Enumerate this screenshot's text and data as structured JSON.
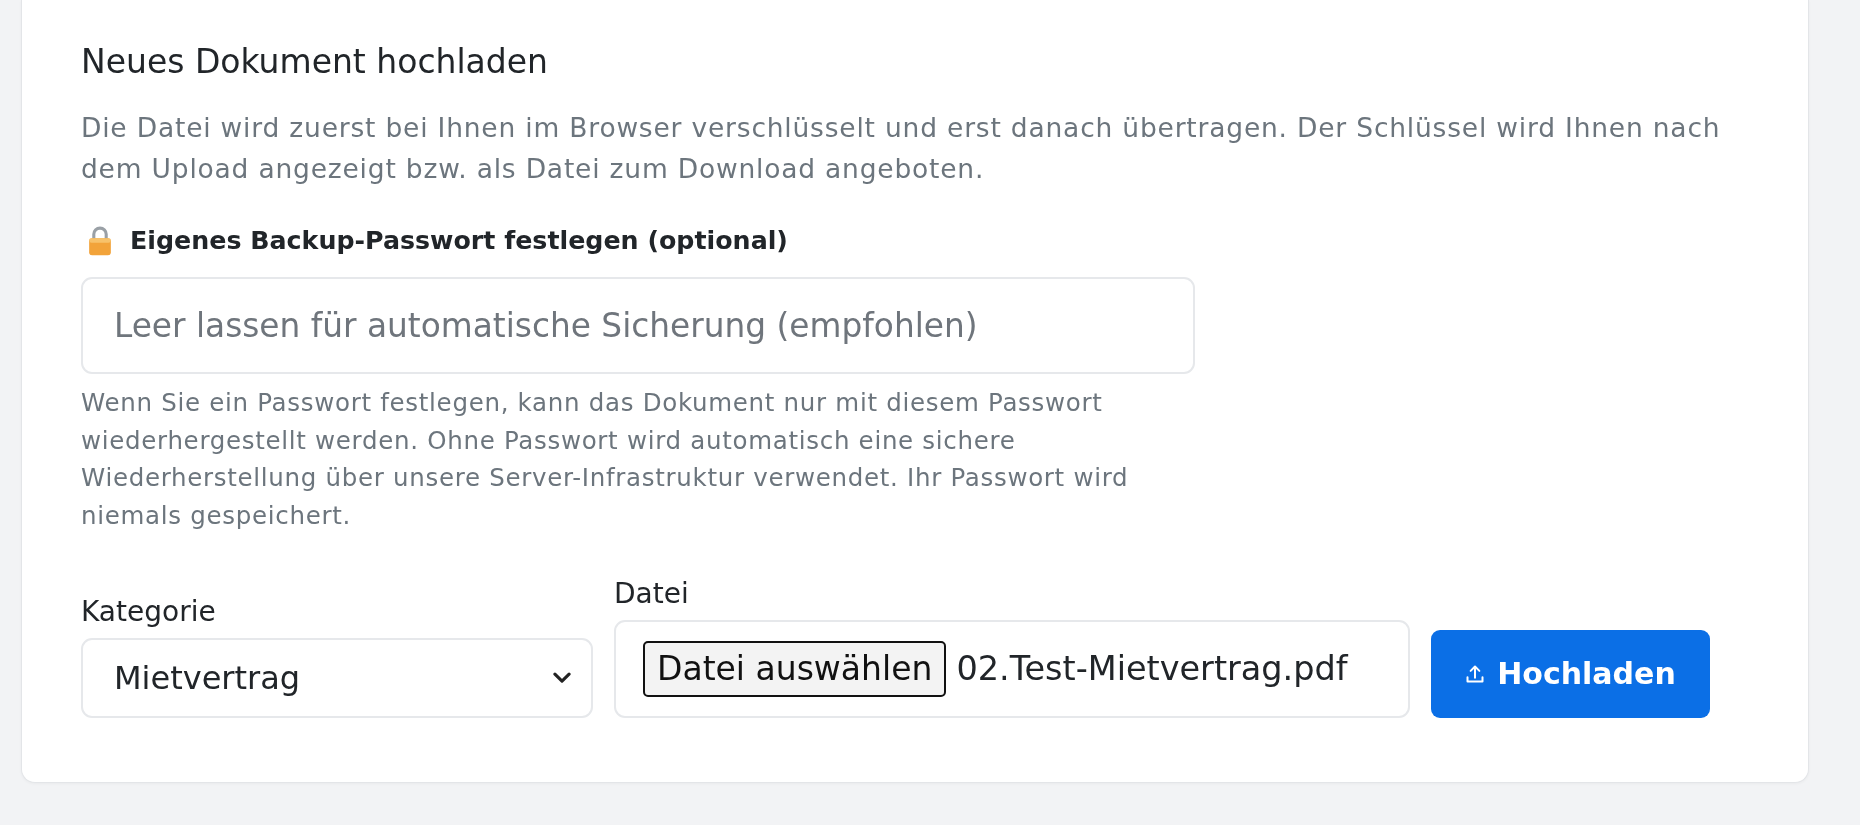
{
  "upload_card": {
    "title": "Neues Dokument hochladen",
    "description": "Die Datei wird zuerst bei Ihnen im Browser verschlüsselt und erst danach übertragen. Der Schlüssel wird Ihnen nach dem Upload angezeigt bzw. als Datei zum Download angeboten.",
    "password": {
      "label": "Eigenes Backup-Passwort festlegen (optional)",
      "placeholder": "Leer lassen für automatische Sicherung (empfohlen)",
      "help": "Wenn Sie ein Passwort festlegen, kann das Dokument nur mit diesem Passwort wiederhergestellt werden. Ohne Passwort wird automatisch eine sichere Wiederherstellung über unsere Server-Infrastruktur verwendet. Ihr Passwort wird niemals gespeichert."
    },
    "category": {
      "label": "Kategorie",
      "value": "Mietvertrag"
    },
    "file": {
      "label": "Datei",
      "button": "Datei auswählen",
      "file_name": "02.Test-Mietvertrag.pdf"
    },
    "submit_button": "Hochladen"
  }
}
